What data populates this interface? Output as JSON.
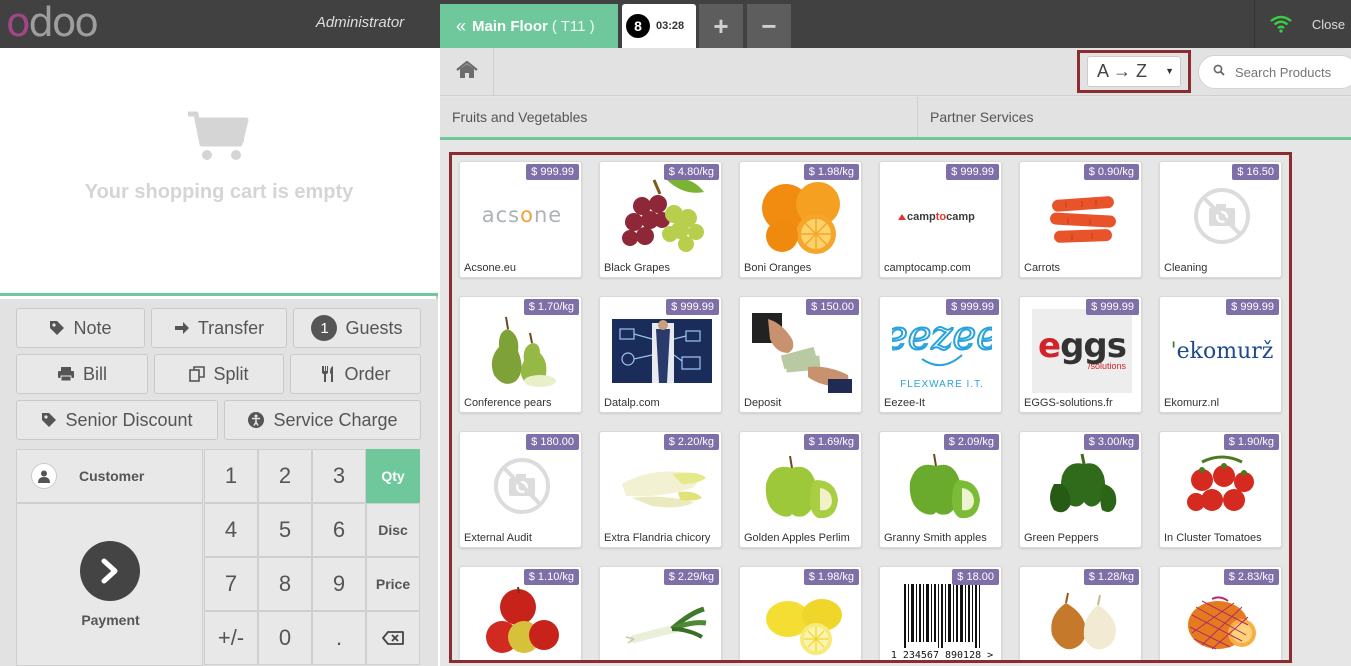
{
  "topbar": {
    "logo": [
      "o",
      "d",
      "o",
      "o"
    ],
    "user": "Administrator",
    "floor_name": "Main Floor",
    "floor_table": "( T11 )",
    "order_number": "8",
    "order_time": "03:28",
    "add_order": "+",
    "remove_order": "−",
    "close": "Close"
  },
  "cart": {
    "empty_message": "Your shopping cart is empty"
  },
  "actions": {
    "note": "Note",
    "transfer": "Transfer",
    "guests_count": "1",
    "guests": "Guests",
    "bill": "Bill",
    "split": "Split",
    "order": "Order",
    "senior_discount": "Senior Discount",
    "service_charge": "Service Charge"
  },
  "numpad": {
    "customer": "Customer",
    "payment": "Payment",
    "keys": [
      "1",
      "2",
      "3",
      "4",
      "5",
      "6",
      "7",
      "8",
      "9",
      "+/-",
      "0",
      "."
    ],
    "modes": [
      "Qty",
      "Disc",
      "Price"
    ],
    "active_mode": "Qty"
  },
  "products_header": {
    "sort_value": "A → Z",
    "search_placeholder": "Search Products",
    "categories": [
      "Fruits and Vegetables",
      "Partner Services"
    ]
  },
  "products": [
    {
      "name": "Acsone.eu",
      "price": "$ 999.99",
      "icon": "acsone-logo"
    },
    {
      "name": "Black Grapes",
      "price": "$ 4.80/kg",
      "icon": "grapes"
    },
    {
      "name": "Boni Oranges",
      "price": "$ 1.98/kg",
      "icon": "oranges"
    },
    {
      "name": "camptocamp.com",
      "price": "$ 999.99",
      "icon": "camptocamp-logo"
    },
    {
      "name": "Carrots",
      "price": "$ 0.90/kg",
      "icon": "carrots"
    },
    {
      "name": "Cleaning",
      "price": "$ 16.50",
      "icon": "no-image"
    },
    {
      "name": "Conference pears",
      "price": "$ 1.70/kg",
      "icon": "pears"
    },
    {
      "name": "Datalp.com",
      "price": "$ 999.99",
      "icon": "datalp-photo"
    },
    {
      "name": "Deposit",
      "price": "$ 150.00",
      "icon": "money-photo"
    },
    {
      "name": "Eezee-It",
      "price": "$ 999.99",
      "icon": "eezee-logo"
    },
    {
      "name": "EGGS-solutions.fr",
      "price": "$ 999.99",
      "icon": "eggs-logo"
    },
    {
      "name": "Ekomurz.nl",
      "price": "$ 999.99",
      "icon": "ekomurz-logo"
    },
    {
      "name": "External Audit",
      "price": "$ 180.00",
      "icon": "no-image"
    },
    {
      "name": "Extra Flandria chicory",
      "price": "$ 2.20/kg",
      "icon": "chicory"
    },
    {
      "name": "Golden Apples Perlim",
      "price": "$ 1.69/kg",
      "icon": "green-apples"
    },
    {
      "name": "Granny Smith apples",
      "price": "$ 2.09/kg",
      "icon": "green-apples"
    },
    {
      "name": "Green Peppers",
      "price": "$ 3.00/kg",
      "icon": "peppers"
    },
    {
      "name": "In Cluster Tomatoes",
      "price": "$ 1.90/kg",
      "icon": "tomatoes"
    },
    {
      "name": "",
      "price": "$ 1.10/kg",
      "icon": "red-apples"
    },
    {
      "name": "",
      "price": "$ 2.29/kg",
      "icon": "leek"
    },
    {
      "name": "",
      "price": "$ 1.98/kg",
      "icon": "lemons"
    },
    {
      "name": "",
      "price": "$ 18.00",
      "icon": "barcode",
      "barcode_text": "1 234567 890128 >"
    },
    {
      "name": "",
      "price": "$ 1.28/kg",
      "icon": "onions"
    },
    {
      "name": "",
      "price": "$ 2.83/kg",
      "icon": "oranges-net"
    }
  ],
  "colors": {
    "topbar": "#414141",
    "accent_green": "#6ec89b",
    "price_badge": "#7f6fa8",
    "highlight_outline": "#8b2d30",
    "logo_purple": "#a24689"
  }
}
